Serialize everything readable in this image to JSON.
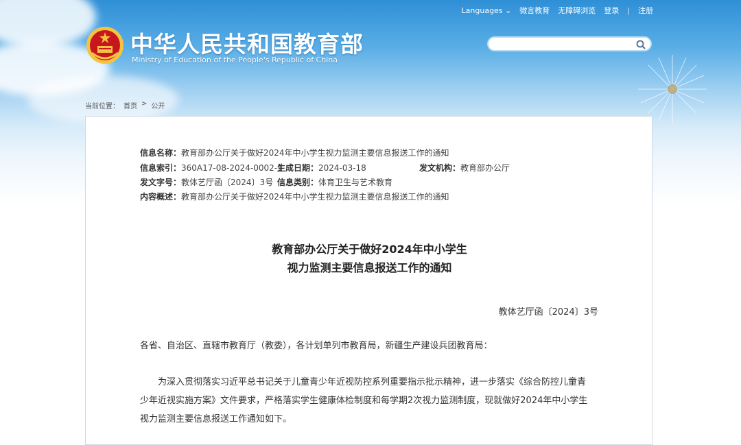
{
  "header": {
    "nav": {
      "languages": "Languages",
      "weibo": "微言教育",
      "accessibility": "无障碍浏览",
      "login": "登录",
      "separator": "|",
      "register": "注册"
    },
    "title_cn": "中华人民共和国教育部",
    "title_en": "Ministry of Education of the People's Republic of China",
    "search": {
      "placeholder": ""
    }
  },
  "breadcrumb": {
    "label": "当前位置：",
    "home": "首页",
    "sep": ">",
    "current": "公开"
  },
  "meta": {
    "name_label": "信息名称：",
    "name_value": "教育部办公厅关于做好2024年中小学生视力监测主要信息报送工作的通知",
    "index_label": "信息索引：",
    "index_value": "360A17-08-2024-0002-1",
    "date_label": "生成日期：",
    "date_value": "2024-03-18",
    "issuer_label": "发文机构：",
    "issuer_value": "教育部办公厅",
    "docno_label": "发文字号：",
    "docno_value": "教体艺厅函〔2024〕3号",
    "category_label": "信息类别：",
    "category_value": "体育卫生与艺术教育",
    "summary_label": "内容概述：",
    "summary_value": "教育部办公厅关于做好2024年中小学生视力监测主要信息报送工作的通知"
  },
  "document": {
    "title_line1": "教育部办公厅关于做好2024年中小学生",
    "title_line2": "视力监测主要信息报送工作的通知",
    "doc_number": "教体艺厅函〔2024〕3号",
    "salutation": "各省、自治区、直辖市教育厅（教委），各计划单列市教育局，新疆生产建设兵团教育局：",
    "body_line1": "　　为深入贯彻落实习近平总书记关于儿童青少年近视防控系列重要指示批示精神，进一步落实《综合防控儿童青",
    "body_line2": "少年近视实施方案》文件要求，严格落实学生健康体检制度和每学期2次视力监测制度，现就做好2024年中小学生",
    "body_line3": "视力监测主要信息报送工作通知如下。"
  },
  "colors": {
    "emblem_red": "#c8161d",
    "emblem_gold": "#f5c342",
    "sky_blue": "#2f8fd6"
  },
  "icons": {
    "search": "search-icon",
    "emblem": "national-emblem-icon",
    "languages_dropdown": "chevron-down-icon"
  }
}
